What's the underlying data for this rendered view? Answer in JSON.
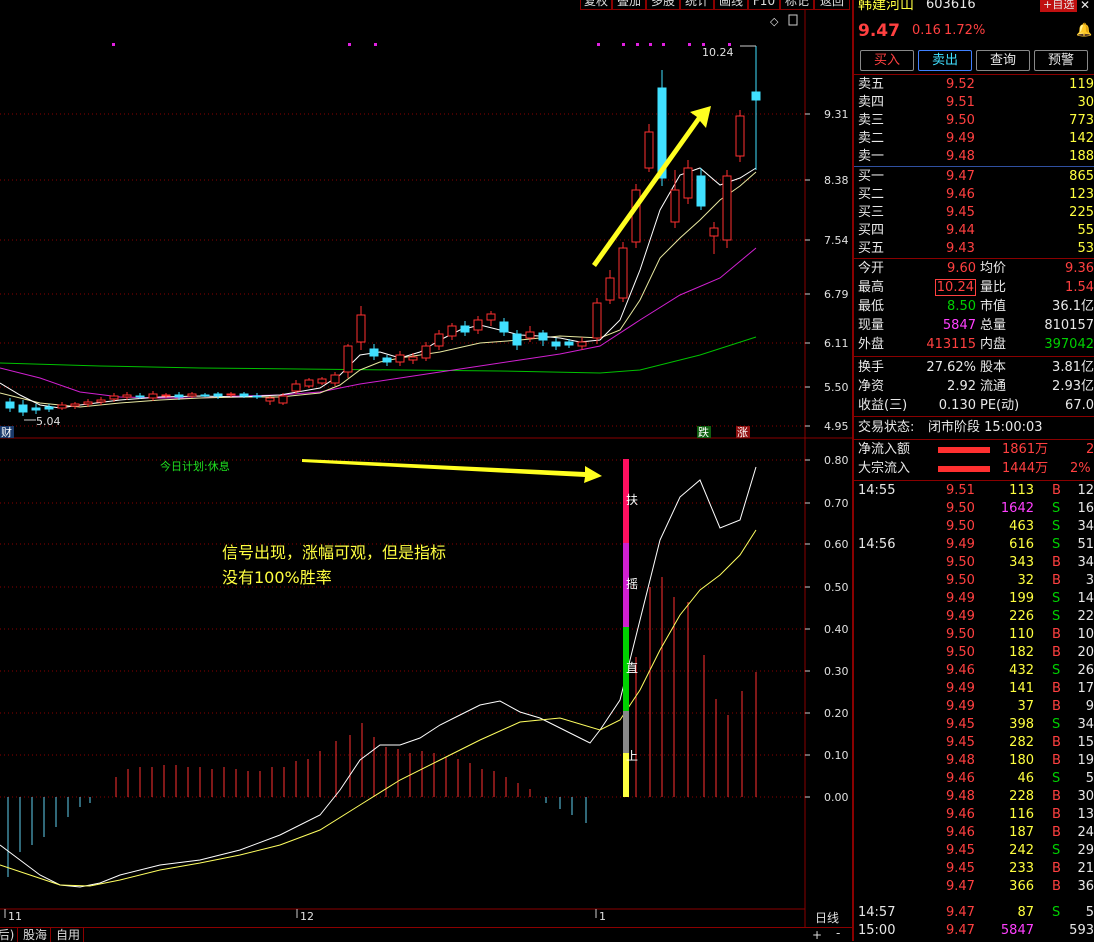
{
  "toolbar": {
    "buttons": [
      "复权",
      "叠加",
      "多股",
      "统计",
      "画线",
      "F10",
      "标记",
      "返回"
    ]
  },
  "stock": {
    "name": "韩建河山",
    "code": "603616",
    "add_watch": "+自选",
    "price": "9.47",
    "change": "0.16",
    "change_pct": "1.72%"
  },
  "trade_buttons": {
    "buy": "买入",
    "sell": "卖出",
    "query": "查询",
    "alert": "预警"
  },
  "order_book": {
    "asks": [
      {
        "label": "卖五",
        "price": "9.52",
        "vol": "119"
      },
      {
        "label": "卖四",
        "price": "9.51",
        "vol": "30"
      },
      {
        "label": "卖三",
        "price": "9.50",
        "vol": "773"
      },
      {
        "label": "卖二",
        "price": "9.49",
        "vol": "142"
      },
      {
        "label": "卖一",
        "price": "9.48",
        "vol": "188"
      }
    ],
    "bids": [
      {
        "label": "买一",
        "price": "9.47",
        "vol": "865"
      },
      {
        "label": "买二",
        "price": "9.46",
        "vol": "123"
      },
      {
        "label": "买三",
        "price": "9.45",
        "vol": "225"
      },
      {
        "label": "买四",
        "price": "9.44",
        "vol": "55"
      },
      {
        "label": "买五",
        "price": "9.43",
        "vol": "53"
      }
    ]
  },
  "stats": {
    "open_l": "今开",
    "open_v": "9.60",
    "avg_l": "均价",
    "avg_v": "9.36",
    "high_l": "最高",
    "high_v": "10.24",
    "volratio_l": "量比",
    "volratio_v": "1.54",
    "low_l": "最低",
    "low_v": "8.50",
    "mcap_l": "市值",
    "mcap_v": "36.1亿",
    "curvol_l": "现量",
    "curvol_v": "5847",
    "totvol_l": "总量",
    "totvol_v": "810157",
    "outer_l": "外盘",
    "outer_v": "413115",
    "inner_l": "内盘",
    "inner_v": "397042",
    "turnover_l": "换手",
    "turnover_v": "27.62%",
    "shares_l": "股本",
    "shares_v": "3.81亿",
    "netasset_l": "净资",
    "netasset_v": "2.92",
    "float_l": "流通",
    "float_v": "2.93亿",
    "eps_l": "收益(三)",
    "eps_v": "0.130",
    "pe_l": "PE(动)",
    "pe_v": "67.0"
  },
  "trade_status": {
    "label": "交易状态:",
    "value": "闭市阶段 15:00:03"
  },
  "flows": {
    "net_l": "净流入额",
    "net_v": "1861万",
    "net_p": "2",
    "block_l": "大宗流入",
    "block_v": "1444万",
    "block_p": "2%"
  },
  "ticks": [
    {
      "t": "14:55",
      "p": "9.51",
      "v": "113",
      "s": "B",
      "n": "12"
    },
    {
      "t": "",
      "p": "9.50",
      "v": "1642",
      "s": "S",
      "n": "16"
    },
    {
      "t": "",
      "p": "9.50",
      "v": "463",
      "s": "S",
      "n": "34"
    },
    {
      "t": "14:56",
      "p": "9.49",
      "v": "616",
      "s": "S",
      "n": "51"
    },
    {
      "t": "",
      "p": "9.50",
      "v": "343",
      "s": "B",
      "n": "34"
    },
    {
      "t": "",
      "p": "9.50",
      "v": "32",
      "s": "B",
      "n": "3"
    },
    {
      "t": "",
      "p": "9.49",
      "v": "199",
      "s": "S",
      "n": "14"
    },
    {
      "t": "",
      "p": "9.49",
      "v": "226",
      "s": "S",
      "n": "22"
    },
    {
      "t": "",
      "p": "9.50",
      "v": "110",
      "s": "B",
      "n": "10"
    },
    {
      "t": "",
      "p": "9.50",
      "v": "182",
      "s": "B",
      "n": "20"
    },
    {
      "t": "",
      "p": "9.46",
      "v": "432",
      "s": "S",
      "n": "26"
    },
    {
      "t": "",
      "p": "9.49",
      "v": "141",
      "s": "B",
      "n": "17"
    },
    {
      "t": "",
      "p": "9.49",
      "v": "37",
      "s": "B",
      "n": "9"
    },
    {
      "t": "",
      "p": "9.45",
      "v": "398",
      "s": "S",
      "n": "34"
    },
    {
      "t": "",
      "p": "9.45",
      "v": "282",
      "s": "B",
      "n": "15"
    },
    {
      "t": "",
      "p": "9.48",
      "v": "180",
      "s": "B",
      "n": "19"
    },
    {
      "t": "",
      "p": "9.46",
      "v": "46",
      "s": "S",
      "n": "5"
    },
    {
      "t": "",
      "p": "9.48",
      "v": "228",
      "s": "B",
      "n": "30"
    },
    {
      "t": "",
      "p": "9.46",
      "v": "116",
      "s": "B",
      "n": "13"
    },
    {
      "t": "",
      "p": "9.46",
      "v": "187",
      "s": "B",
      "n": "24"
    },
    {
      "t": "",
      "p": "9.45",
      "v": "242",
      "s": "S",
      "n": "29"
    },
    {
      "t": "",
      "p": "9.45",
      "v": "233",
      "s": "B",
      "n": "21"
    },
    {
      "t": "",
      "p": "9.47",
      "v": "366",
      "s": "B",
      "n": "36"
    },
    {
      "t": "14:57",
      "p": "9.47",
      "v": "87",
      "s": "S",
      "n": "5"
    },
    {
      "t": "15:00",
      "p": "9.47",
      "v": "5847",
      "s": "",
      "n": "593"
    }
  ],
  "price_axis": [
    "9.31",
    "8.38",
    "7.54",
    "6.79",
    "6.11",
    "5.50",
    "4.95"
  ],
  "indicator_axis": [
    "0.80",
    "0.70",
    "0.60",
    "0.50",
    "0.40",
    "0.30",
    "0.20",
    "0.10",
    "0.00"
  ],
  "annotations": {
    "high_label": "10.24",
    "low_label": "5.04",
    "plan_text": "今日计划:休息",
    "signal_line1": "信号出现，涨幅可观，但是指标",
    "signal_line2": "没有100%胜率",
    "bar_labels": [
      "扶",
      "摇",
      "直",
      "上"
    ],
    "cai_tag": "财",
    "die_tag": "跌",
    "zhang_tag": "涨"
  },
  "date_axis": [
    "11",
    "12",
    "1"
  ],
  "period": "日线",
  "bottom_tabs": [
    "(后)",
    "股海",
    "自用"
  ],
  "colors": {
    "up": "#ff3030",
    "down": "#40e0ff",
    "bg": "#000000",
    "grid": "#8a0000"
  }
}
